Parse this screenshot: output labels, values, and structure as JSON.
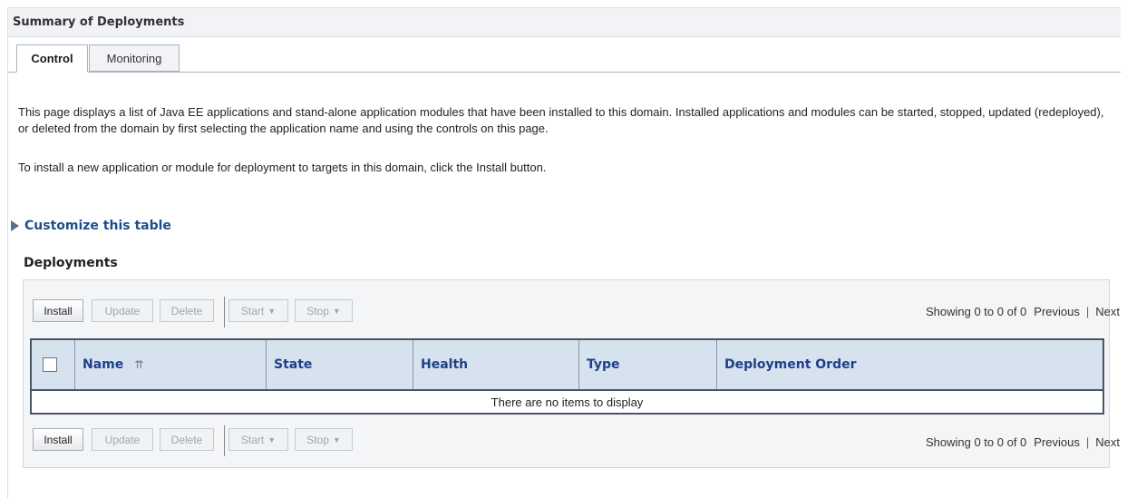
{
  "header": {
    "title": "Summary of Deployments"
  },
  "tabs": [
    {
      "label": "Control",
      "active": true
    },
    {
      "label": "Monitoring",
      "active": false
    }
  ],
  "intro": {
    "p1": "This page displays a list of Java EE applications and stand-alone application modules that have been installed to this domain. Installed applications and modules can be started, stopped, updated (redeployed), or deleted from the domain by first selecting the application name and using the controls on this page.",
    "p2": "To install a new application or module for deployment to targets in this domain, click the Install button."
  },
  "customize": {
    "label": "Customize this table",
    "icon": "triangle-right-icon"
  },
  "section": {
    "label": "Deployments"
  },
  "toolbar": {
    "install": "Install",
    "update": "Update",
    "delete": "Delete",
    "start": "Start",
    "stop": "Stop",
    "dropdown_glyph": "⌵"
  },
  "pager": {
    "showing": "Showing 0 to 0 of 0",
    "previous": "Previous",
    "separator": "|",
    "next": "Next"
  },
  "table": {
    "columns": [
      "Name",
      "State",
      "Health",
      "Type",
      "Deployment Order"
    ],
    "sort_icon": "⇈",
    "empty_message": "There are no items to display"
  },
  "colors": {
    "accent": "#1f3f8a",
    "header_bg": "#d7e2ef",
    "link": "#1f4e8c"
  }
}
